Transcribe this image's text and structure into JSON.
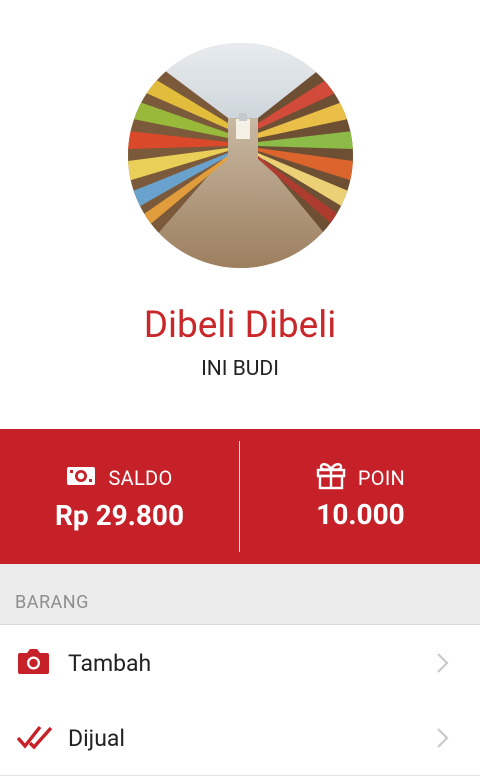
{
  "profile": {
    "name": "Dibeli Dibeli",
    "username": "INI BUDI",
    "avatar_icon": "supermarket-aisle-photo"
  },
  "stats": {
    "saldo": {
      "label": "SALDO",
      "value": "Rp 29.800",
      "icon": "money-icon"
    },
    "poin": {
      "label": "POIN",
      "value": "10.000",
      "icon": "gift-icon"
    }
  },
  "barang": {
    "title": "BARANG",
    "items": [
      {
        "label": "Tambah",
        "icon": "camera-icon"
      },
      {
        "label": "Dijual",
        "icon": "double-check-icon"
      }
    ]
  },
  "colors": {
    "brand_red": "#c62128",
    "name_red": "#c8282a",
    "section_bg": "#ececec",
    "section_text": "#8e8e8e"
  }
}
